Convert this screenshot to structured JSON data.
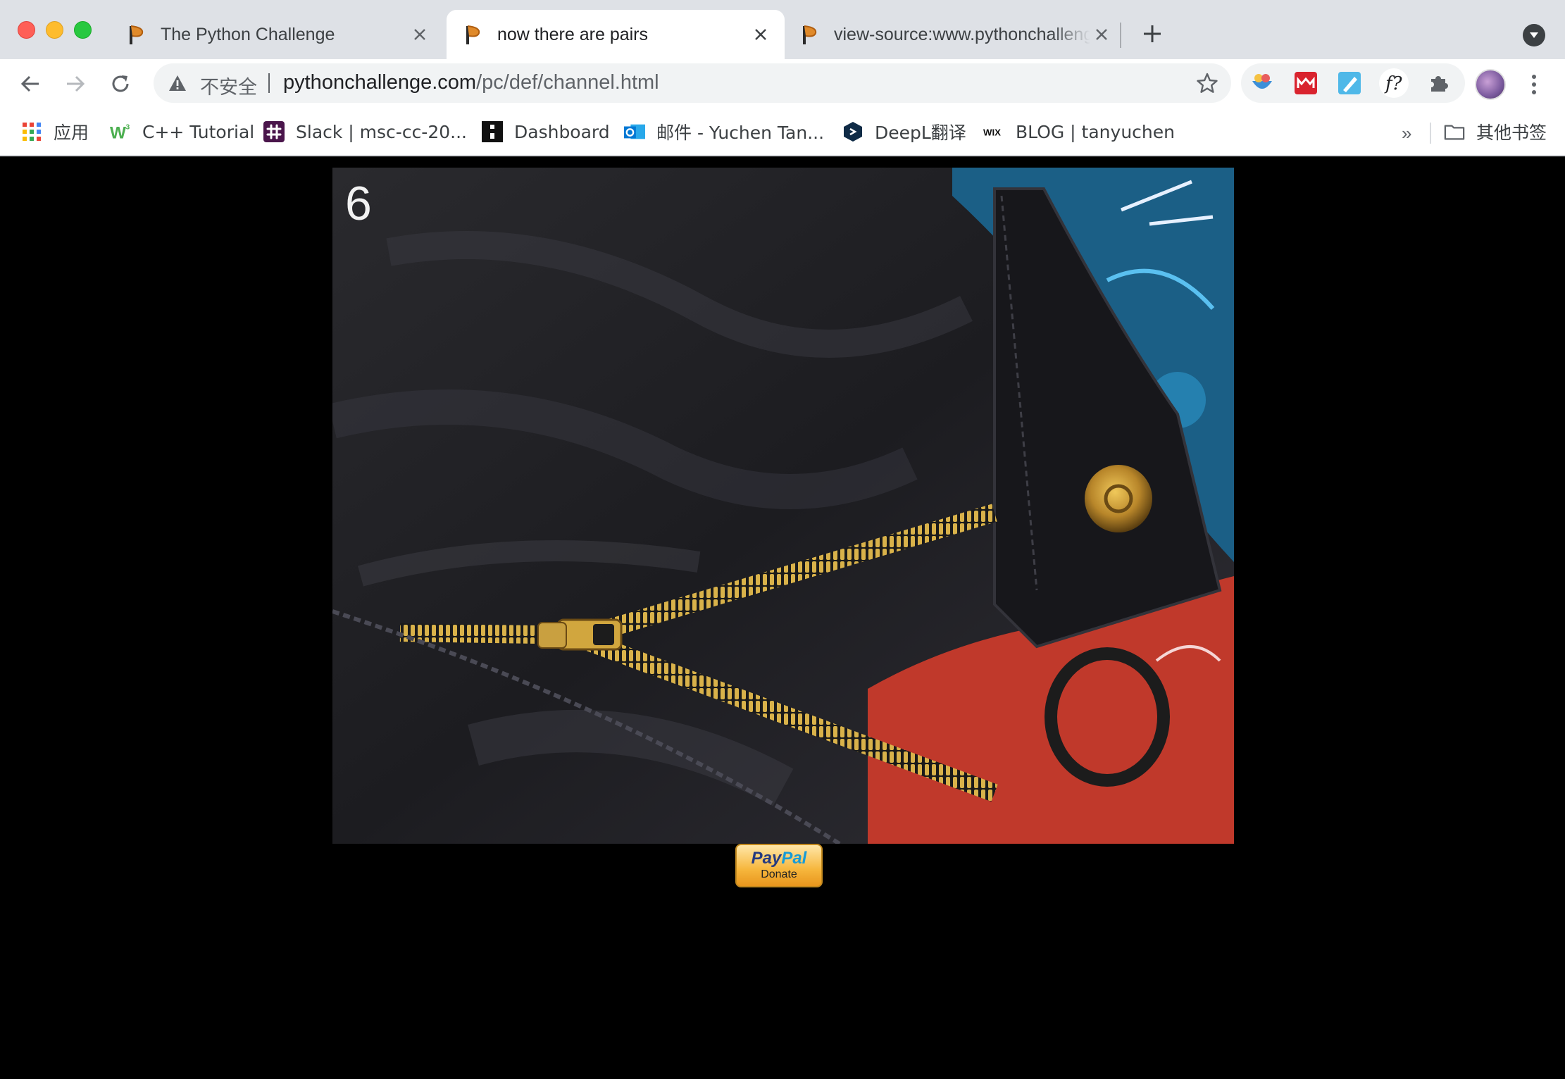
{
  "window": {
    "tabs": [
      {
        "title": "The Python Challenge",
        "active": false
      },
      {
        "title": "now there are pairs",
        "active": true
      },
      {
        "title": "view-source:www.pythonchallenge.com/pc/def/channel.html",
        "active": false
      }
    ]
  },
  "toolbar": {
    "security_label": "不安全",
    "url_host": "pythonchallenge.com",
    "url_path": "/pc/def/channel.html"
  },
  "bookmarks": {
    "items": [
      {
        "label": "应用",
        "icon": "apps-grid-icon"
      },
      {
        "label": "C++ Tutorial",
        "icon": "w3schools-icon"
      },
      {
        "label": "Slack | msc-cc-20...",
        "icon": "slack-icon"
      },
      {
        "label": "Dashboard",
        "icon": "dashboard-icon"
      },
      {
        "label": "邮件 - Yuchen Tan...",
        "icon": "outlook-icon"
      },
      {
        "label": "DeepL翻译",
        "icon": "deepl-icon"
      },
      {
        "label": "BLOG | tanyuchen",
        "icon": "wix-icon"
      }
    ],
    "more_label": "»",
    "other_label": "其他书签"
  },
  "page": {
    "image_number": "6",
    "donate": {
      "pay": "Pay",
      "pal": "Pal",
      "label": "Donate"
    }
  },
  "colors": {
    "tabstrip_bg": "#dee1e6",
    "page_bg": "#000000"
  }
}
